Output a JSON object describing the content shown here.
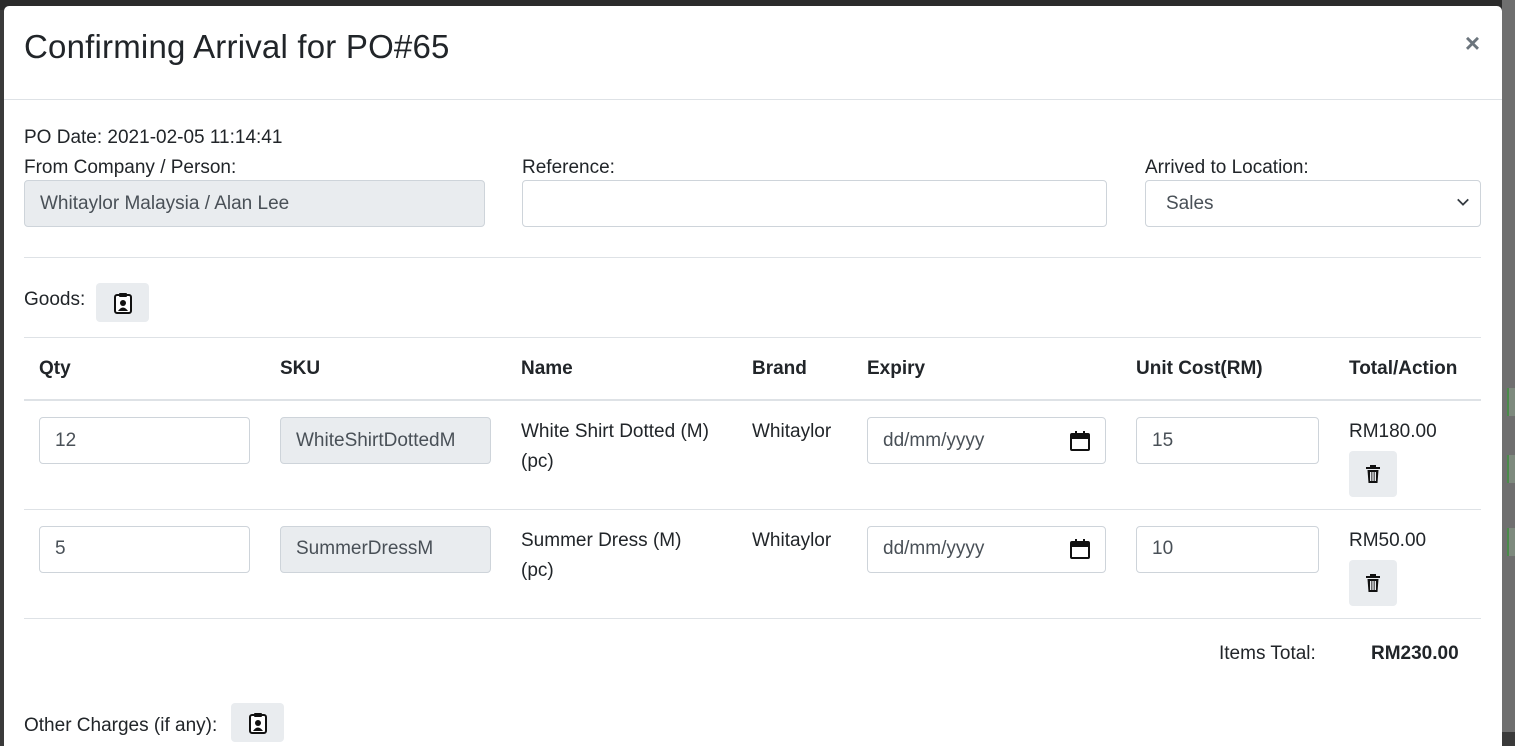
{
  "modal": {
    "title": "Confirming Arrival for PO#65",
    "close_label": "×"
  },
  "po": {
    "date_text": "PO Date: 2021-02-05 11:14:41",
    "company_label": "From Company / Person:",
    "company_value": "Whitaylor Malaysia / Alan Lee",
    "reference_label": "Reference:",
    "reference_value": "",
    "location_label": "Arrived to Location:",
    "location_value": "Sales"
  },
  "goods": {
    "label": "Goods:",
    "icon": "clipboard-user-icon",
    "columns": [
      "Qty",
      "SKU",
      "Name",
      "Brand",
      "Expiry",
      "Unit Cost(RM)",
      "Total/Action"
    ],
    "rows": [
      {
        "qty": "12",
        "sku": "WhiteShirtDottedM",
        "name": "White Shirt Dotted (M)",
        "unit": "(pc)",
        "brand": "Whitaylor",
        "expiry_placeholder": "dd/mm/yyyy",
        "unit_cost": "15",
        "total": "RM180.00"
      },
      {
        "qty": "5",
        "sku": "SummerDressM",
        "name": "Summer Dress (M)",
        "unit": "(pc)",
        "brand": "Whitaylor",
        "expiry_placeholder": "dd/mm/yyyy",
        "unit_cost": "10",
        "total": "RM50.00"
      }
    ],
    "items_total_label": "Items Total:",
    "items_total_value": "RM230.00"
  },
  "other_charges": {
    "label": "Other Charges (if any):",
    "icon": "clipboard-user-icon"
  }
}
